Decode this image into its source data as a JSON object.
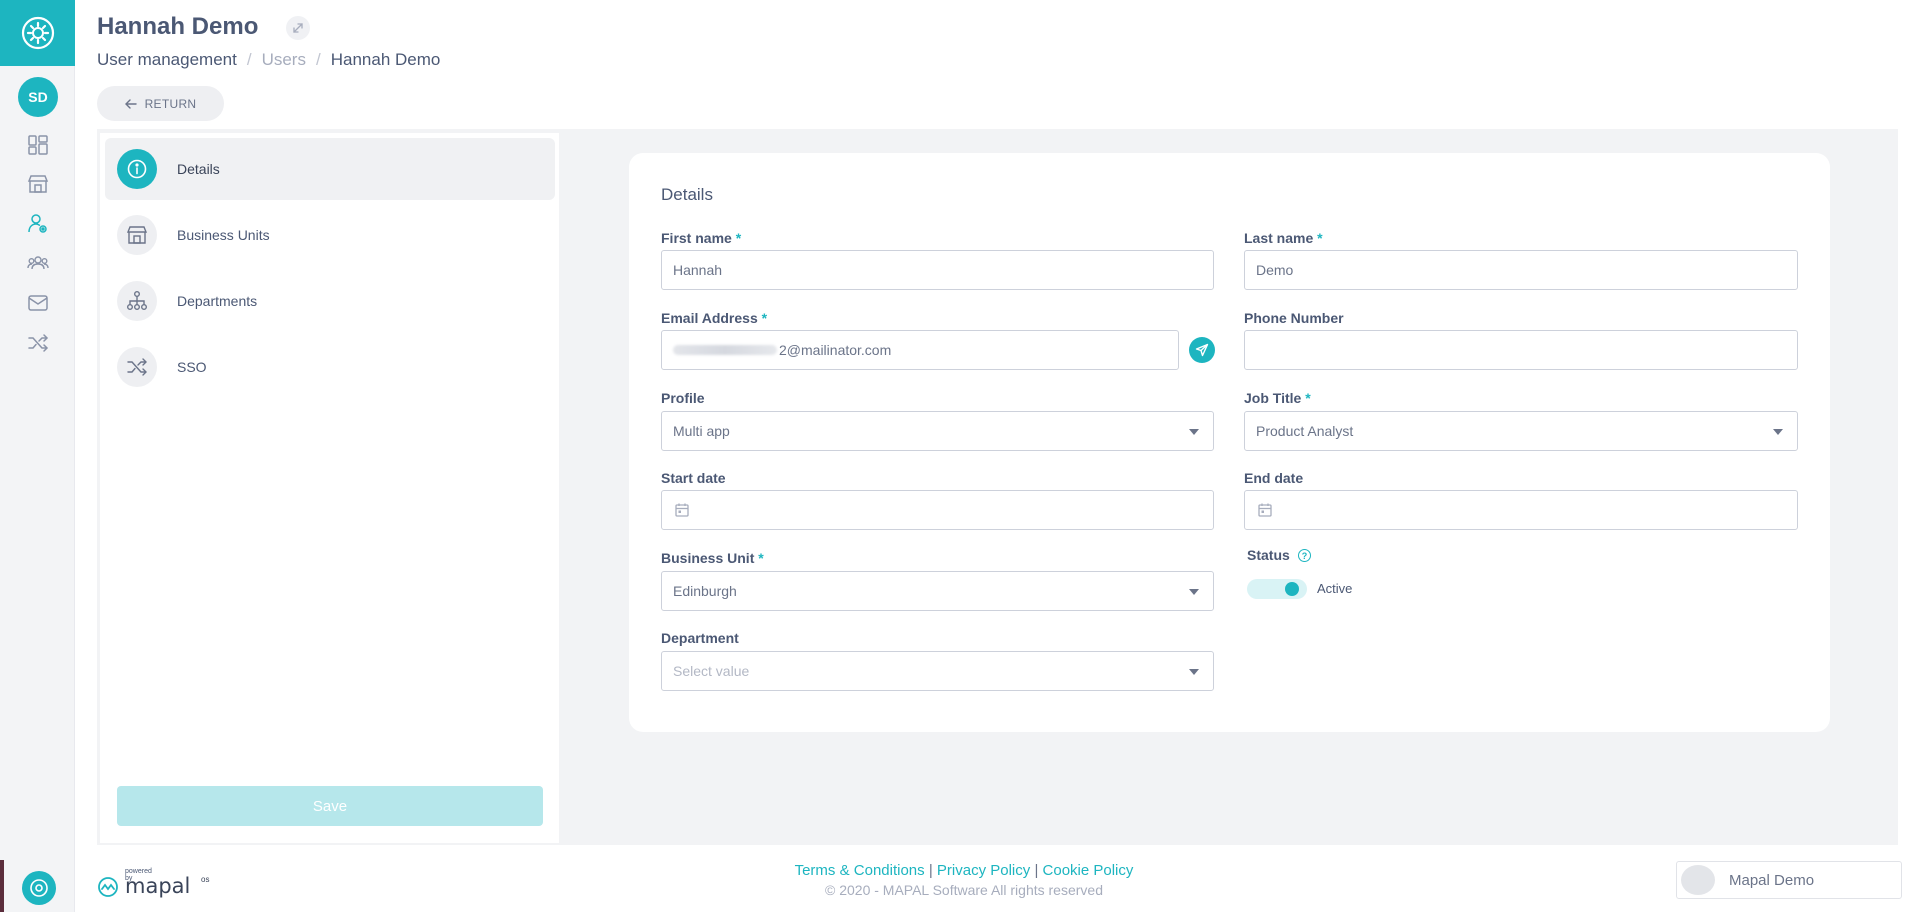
{
  "header": {
    "title": "Hannah Demo",
    "breadcrumb": [
      "User management",
      "Users",
      "Hannah Demo"
    ],
    "breadcrumb_sep": "/",
    "return_label": "RETURN"
  },
  "rail": {
    "avatar_initials": "SD",
    "icons": [
      "settings-icon",
      "dashboard-icon",
      "store-icon",
      "user-settings-icon",
      "team-icon",
      "mail-icon",
      "shuffle-icon"
    ],
    "accent": "#1db5c0"
  },
  "side_nav": {
    "items": [
      {
        "label": "Details",
        "icon": "info-icon"
      },
      {
        "label": "Business Units",
        "icon": "store-icon"
      },
      {
        "label": "Departments",
        "icon": "hierarchy-icon"
      },
      {
        "label": "SSO",
        "icon": "shuffle-icon"
      }
    ],
    "save_label": "Save"
  },
  "form": {
    "title": "Details",
    "first_name": {
      "label": "First name",
      "required": "*",
      "value": "Hannah"
    },
    "last_name": {
      "label": "Last name",
      "required": "*",
      "value": "Demo"
    },
    "email": {
      "label": "Email Address",
      "required": "*",
      "value_suffix": "2@mailinator.com"
    },
    "phone": {
      "label": "Phone Number",
      "value": ""
    },
    "profile": {
      "label": "Profile",
      "value": "Multi app"
    },
    "job_title": {
      "label": "Job Title",
      "required": "*",
      "value": "Product Analyst"
    },
    "start_date": {
      "label": "Start date",
      "value": ""
    },
    "end_date": {
      "label": "End date",
      "value": ""
    },
    "business_unit": {
      "label": "Business Unit",
      "required": "*",
      "value": "Edinburgh"
    },
    "status": {
      "label": "Status",
      "help": "?",
      "value": "Active",
      "on": true
    },
    "department": {
      "label": "Department",
      "placeholder": "Select value"
    }
  },
  "footer": {
    "links": [
      "Terms & Conditions",
      "Privacy Policy",
      "Cookie Policy"
    ],
    "link_sep": "|",
    "copyright": "© 2020 - MAPAL Software All rights reserved",
    "powered_by": "powered by",
    "brand": "mapal",
    "brand_suffix": "os",
    "user_name": "Mapal Demo"
  }
}
